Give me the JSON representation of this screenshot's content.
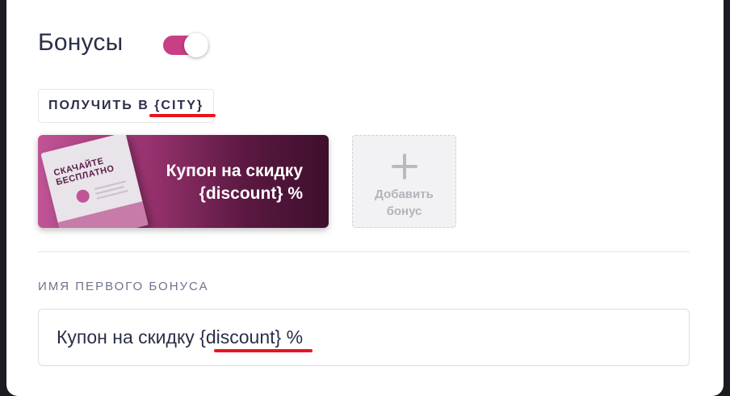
{
  "bonuses": {
    "title": "Бонусы",
    "toggle_on": true,
    "accent_color": "#c83f86",
    "tag": {
      "prefix": "ПОЛУЧИТЬ В ",
      "variable": "{CITY}"
    },
    "card": {
      "booklet_title": "СКАЧАЙТЕ БЕСПЛАТНО",
      "booklet_icon": "download-icon",
      "text_line1": "Купон на скидку",
      "text_line2": "{discount} %"
    },
    "add_button": {
      "icon": "plus-icon",
      "label_line1": "Добавить",
      "label_line2": "бонус"
    }
  },
  "first_bonus_field": {
    "label": "ИМЯ ПЕРВОГО БОНУСА",
    "value_prefix": "Купон на скидку ",
    "value_variable": "{discount}",
    "value_suffix": " %"
  },
  "annotation_color": "#e8141e"
}
